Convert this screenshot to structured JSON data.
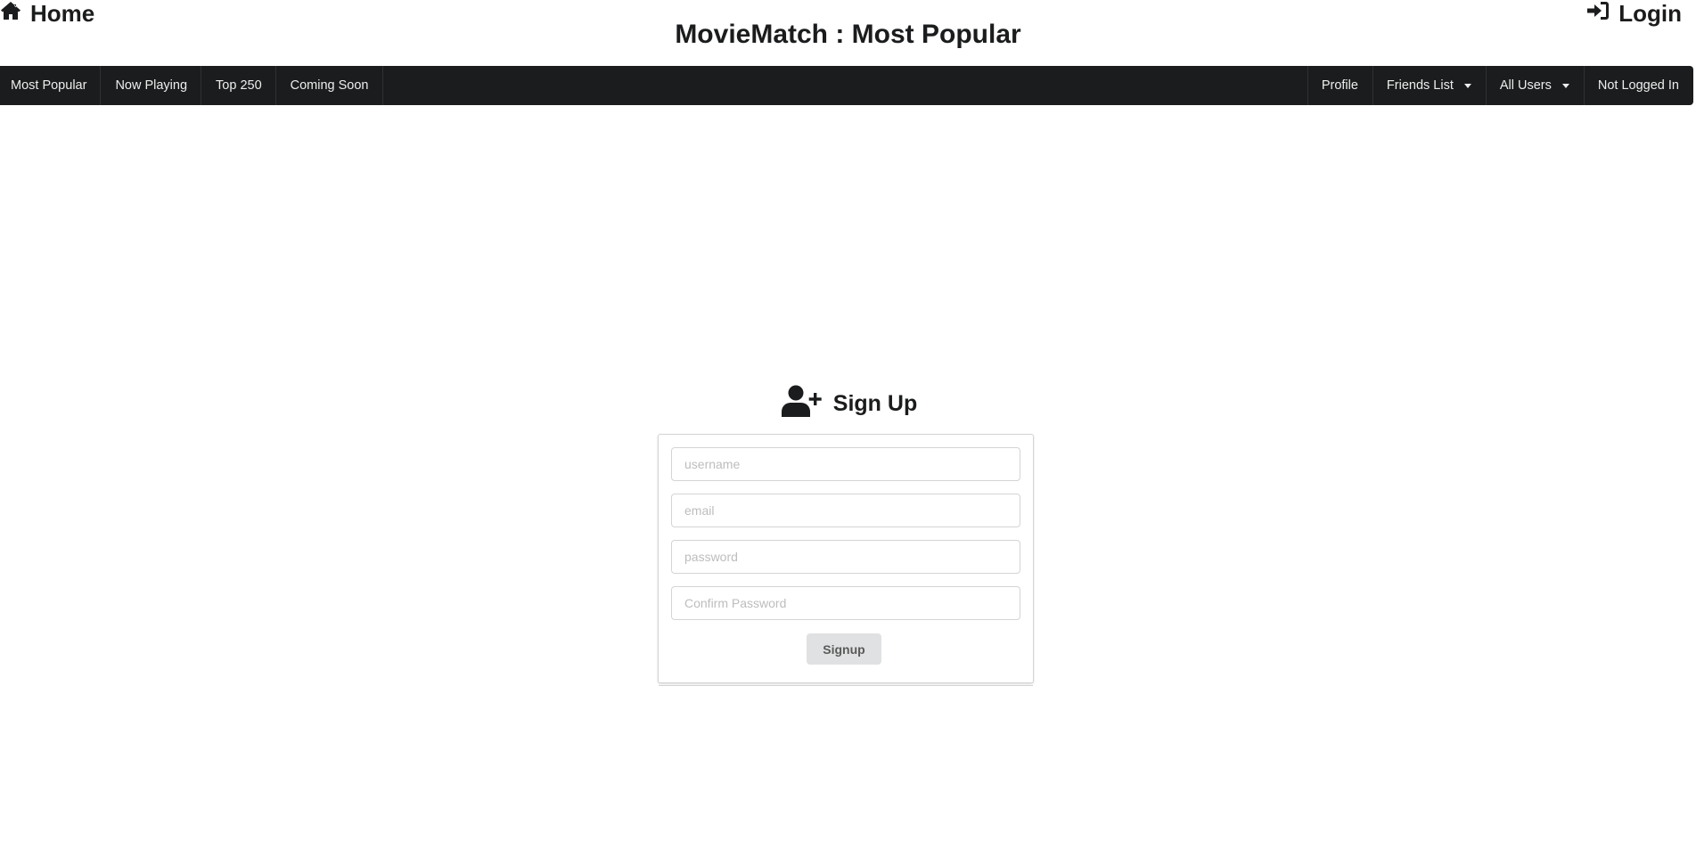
{
  "header": {
    "home_label": "Home",
    "login_label": "Login",
    "title": "MovieMatch : Most Popular"
  },
  "nav": {
    "left": [
      "Most Popular",
      "Now Playing",
      "Top 250",
      "Coming Soon"
    ],
    "right": {
      "profile": "Profile",
      "friends": "Friends List",
      "users": "All Users",
      "status": "Not Logged In"
    }
  },
  "signup": {
    "title": "Sign Up",
    "username_placeholder": "username",
    "email_placeholder": "email",
    "password_placeholder": "password",
    "confirm_placeholder": "Confirm Password",
    "button_label": "Signup"
  },
  "icons": {
    "home": "home-icon",
    "login": "sign-in-icon",
    "signup": "user-plus-icon",
    "dropdown": "caret-down-icon"
  },
  "colors": {
    "navbar": "#1b1c1d",
    "button": "#e0e1e2"
  }
}
